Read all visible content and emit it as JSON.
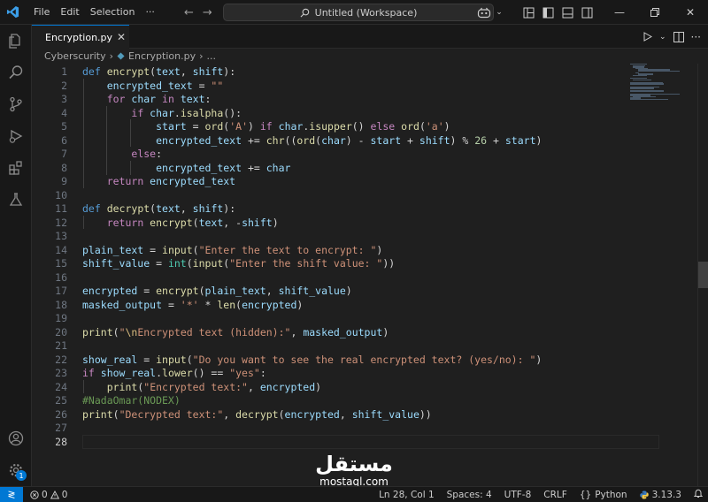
{
  "titlebar": {
    "menu": [
      "File",
      "Edit",
      "Selection",
      "···"
    ],
    "search": "Untitled (Workspace)"
  },
  "tab": {
    "label": "Encryption.py",
    "close": "✕"
  },
  "breadcrumb": {
    "folder": "Cyberscurity",
    "separator": "›",
    "file": "Encryption.py",
    "more": "..."
  },
  "editor": {
    "active_line": 28,
    "lines": [
      {
        "n": "1",
        "tokens": [
          [
            "kw",
            "def "
          ],
          [
            "fn",
            "encrypt"
          ],
          [
            "op",
            "("
          ],
          [
            "var",
            "text"
          ],
          [
            "op",
            ", "
          ],
          [
            "var",
            "shift"
          ],
          [
            "op",
            "):"
          ]
        ]
      },
      {
        "n": "2",
        "tokens": [
          [
            "op",
            "    "
          ],
          [
            "var",
            "encrypted_text"
          ],
          [
            "op",
            " = "
          ],
          [
            "str",
            "\"\""
          ]
        ]
      },
      {
        "n": "3",
        "tokens": [
          [
            "op",
            "    "
          ],
          [
            "ctl",
            "for "
          ],
          [
            "var",
            "char"
          ],
          [
            "ctl",
            " in "
          ],
          [
            "var",
            "text"
          ],
          [
            "op",
            ":"
          ]
        ]
      },
      {
        "n": "4",
        "tokens": [
          [
            "op",
            "        "
          ],
          [
            "ctl",
            "if "
          ],
          [
            "var",
            "char"
          ],
          [
            "op",
            "."
          ],
          [
            "fn",
            "isalpha"
          ],
          [
            "op",
            "():"
          ]
        ]
      },
      {
        "n": "5",
        "tokens": [
          [
            "op",
            "            "
          ],
          [
            "var",
            "start"
          ],
          [
            "op",
            " = "
          ],
          [
            "fn",
            "ord"
          ],
          [
            "op",
            "("
          ],
          [
            "str",
            "'A'"
          ],
          [
            "op",
            ") "
          ],
          [
            "ctl",
            "if "
          ],
          [
            "var",
            "char"
          ],
          [
            "op",
            "."
          ],
          [
            "fn",
            "isupper"
          ],
          [
            "op",
            "() "
          ],
          [
            "ctl",
            "else "
          ],
          [
            "fn",
            "ord"
          ],
          [
            "op",
            "("
          ],
          [
            "str",
            "'a'"
          ],
          [
            "op",
            ")"
          ]
        ]
      },
      {
        "n": "6",
        "tokens": [
          [
            "op",
            "            "
          ],
          [
            "var",
            "encrypted_text"
          ],
          [
            "op",
            " += "
          ],
          [
            "fn",
            "chr"
          ],
          [
            "op",
            "(("
          ],
          [
            "fn",
            "ord"
          ],
          [
            "op",
            "("
          ],
          [
            "var",
            "char"
          ],
          [
            "op",
            ") - "
          ],
          [
            "var",
            "start"
          ],
          [
            "op",
            " + "
          ],
          [
            "var",
            "shift"
          ],
          [
            "op",
            ") % "
          ],
          [
            "num",
            "26"
          ],
          [
            "op",
            " + "
          ],
          [
            "var",
            "start"
          ],
          [
            "op",
            ")"
          ]
        ]
      },
      {
        "n": "7",
        "tokens": [
          [
            "op",
            "        "
          ],
          [
            "ctl",
            "else"
          ],
          [
            "op",
            ":"
          ]
        ]
      },
      {
        "n": "8",
        "tokens": [
          [
            "op",
            "            "
          ],
          [
            "var",
            "encrypted_text"
          ],
          [
            "op",
            " += "
          ],
          [
            "var",
            "char"
          ]
        ]
      },
      {
        "n": "9",
        "tokens": [
          [
            "op",
            "    "
          ],
          [
            "ctl",
            "return "
          ],
          [
            "var",
            "encrypted_text"
          ]
        ]
      },
      {
        "n": "10",
        "tokens": []
      },
      {
        "n": "11",
        "tokens": [
          [
            "kw",
            "def "
          ],
          [
            "fn",
            "decrypt"
          ],
          [
            "op",
            "("
          ],
          [
            "var",
            "text"
          ],
          [
            "op",
            ", "
          ],
          [
            "var",
            "shift"
          ],
          [
            "op",
            "):"
          ]
        ]
      },
      {
        "n": "12",
        "tokens": [
          [
            "op",
            "    "
          ],
          [
            "ctl",
            "return "
          ],
          [
            "fn",
            "encrypt"
          ],
          [
            "op",
            "("
          ],
          [
            "var",
            "text"
          ],
          [
            "op",
            ", -"
          ],
          [
            "var",
            "shift"
          ],
          [
            "op",
            ")"
          ]
        ]
      },
      {
        "n": "13",
        "tokens": []
      },
      {
        "n": "14",
        "tokens": [
          [
            "var",
            "plain_text"
          ],
          [
            "op",
            " = "
          ],
          [
            "fn",
            "input"
          ],
          [
            "op",
            "("
          ],
          [
            "str",
            "\"Enter the text to encrypt: \""
          ],
          [
            "op",
            ")"
          ]
        ]
      },
      {
        "n": "15",
        "tokens": [
          [
            "var",
            "shift_value"
          ],
          [
            "op",
            " = "
          ],
          [
            "cls",
            "int"
          ],
          [
            "op",
            "("
          ],
          [
            "fn",
            "input"
          ],
          [
            "op",
            "("
          ],
          [
            "str",
            "\"Enter the shift value: \""
          ],
          [
            "op",
            "))"
          ]
        ]
      },
      {
        "n": "16",
        "tokens": []
      },
      {
        "n": "17",
        "tokens": [
          [
            "var",
            "encrypted"
          ],
          [
            "op",
            " = "
          ],
          [
            "fn",
            "encrypt"
          ],
          [
            "op",
            "("
          ],
          [
            "var",
            "plain_text"
          ],
          [
            "op",
            ", "
          ],
          [
            "var",
            "shift_value"
          ],
          [
            "op",
            ")"
          ]
        ]
      },
      {
        "n": "18",
        "tokens": [
          [
            "var",
            "masked_output"
          ],
          [
            "op",
            " = "
          ],
          [
            "str",
            "'*'"
          ],
          [
            "op",
            " * "
          ],
          [
            "fn",
            "len"
          ],
          [
            "op",
            "("
          ],
          [
            "var",
            "encrypted"
          ],
          [
            "op",
            ")"
          ]
        ]
      },
      {
        "n": "19",
        "tokens": []
      },
      {
        "n": "20",
        "tokens": [
          [
            "fn",
            "print"
          ],
          [
            "op",
            "("
          ],
          [
            "str",
            "\""
          ],
          [
            "esc",
            "\\n"
          ],
          [
            "str",
            "Encrypted text (hidden):\""
          ],
          [
            "op",
            ", "
          ],
          [
            "var",
            "masked_output"
          ],
          [
            "op",
            ")"
          ]
        ]
      },
      {
        "n": "21",
        "tokens": []
      },
      {
        "n": "22",
        "tokens": [
          [
            "var",
            "show_real"
          ],
          [
            "op",
            " = "
          ],
          [
            "fn",
            "input"
          ],
          [
            "op",
            "("
          ],
          [
            "str",
            "\"Do you want to see the real encrypted text? (yes/no): \""
          ],
          [
            "op",
            ")"
          ]
        ]
      },
      {
        "n": "23",
        "tokens": [
          [
            "ctl",
            "if "
          ],
          [
            "var",
            "show_real"
          ],
          [
            "op",
            "."
          ],
          [
            "fn",
            "lower"
          ],
          [
            "op",
            "() == "
          ],
          [
            "str",
            "\"yes\""
          ],
          [
            "op",
            ":"
          ]
        ]
      },
      {
        "n": "24",
        "tokens": [
          [
            "op",
            "    "
          ],
          [
            "fn",
            "print"
          ],
          [
            "op",
            "("
          ],
          [
            "str",
            "\"Encrypted text:\""
          ],
          [
            "op",
            ", "
          ],
          [
            "var",
            "encrypted"
          ],
          [
            "op",
            ")"
          ]
        ]
      },
      {
        "n": "25",
        "tokens": [
          [
            "cm",
            "#NadaOmar(NODEX)"
          ]
        ]
      },
      {
        "n": "26",
        "tokens": [
          [
            "fn",
            "print"
          ],
          [
            "op",
            "("
          ],
          [
            "str",
            "\"Decrypted text:\""
          ],
          [
            "op",
            ", "
          ],
          [
            "fn",
            "decrypt"
          ],
          [
            "op",
            "("
          ],
          [
            "var",
            "encrypted"
          ],
          [
            "op",
            ", "
          ],
          [
            "var",
            "shift_value"
          ],
          [
            "op",
            "))"
          ]
        ]
      },
      {
        "n": "27",
        "tokens": []
      },
      {
        "n": "28",
        "tokens": []
      }
    ]
  },
  "watermark": {
    "arabic": "مستقل",
    "latin": "mostaql.com"
  },
  "statusbar": {
    "errors": "0",
    "warnings": "0",
    "position": "Ln 28, Col 1",
    "spaces": "Spaces: 4",
    "encoding": "UTF-8",
    "eol": "CRLF",
    "language": "Python",
    "version": "3.13.3"
  },
  "activity": {
    "badge": "1"
  },
  "colors": {
    "accent": "#0078d4",
    "background": "#1f1f1f",
    "chrome": "#181818"
  }
}
